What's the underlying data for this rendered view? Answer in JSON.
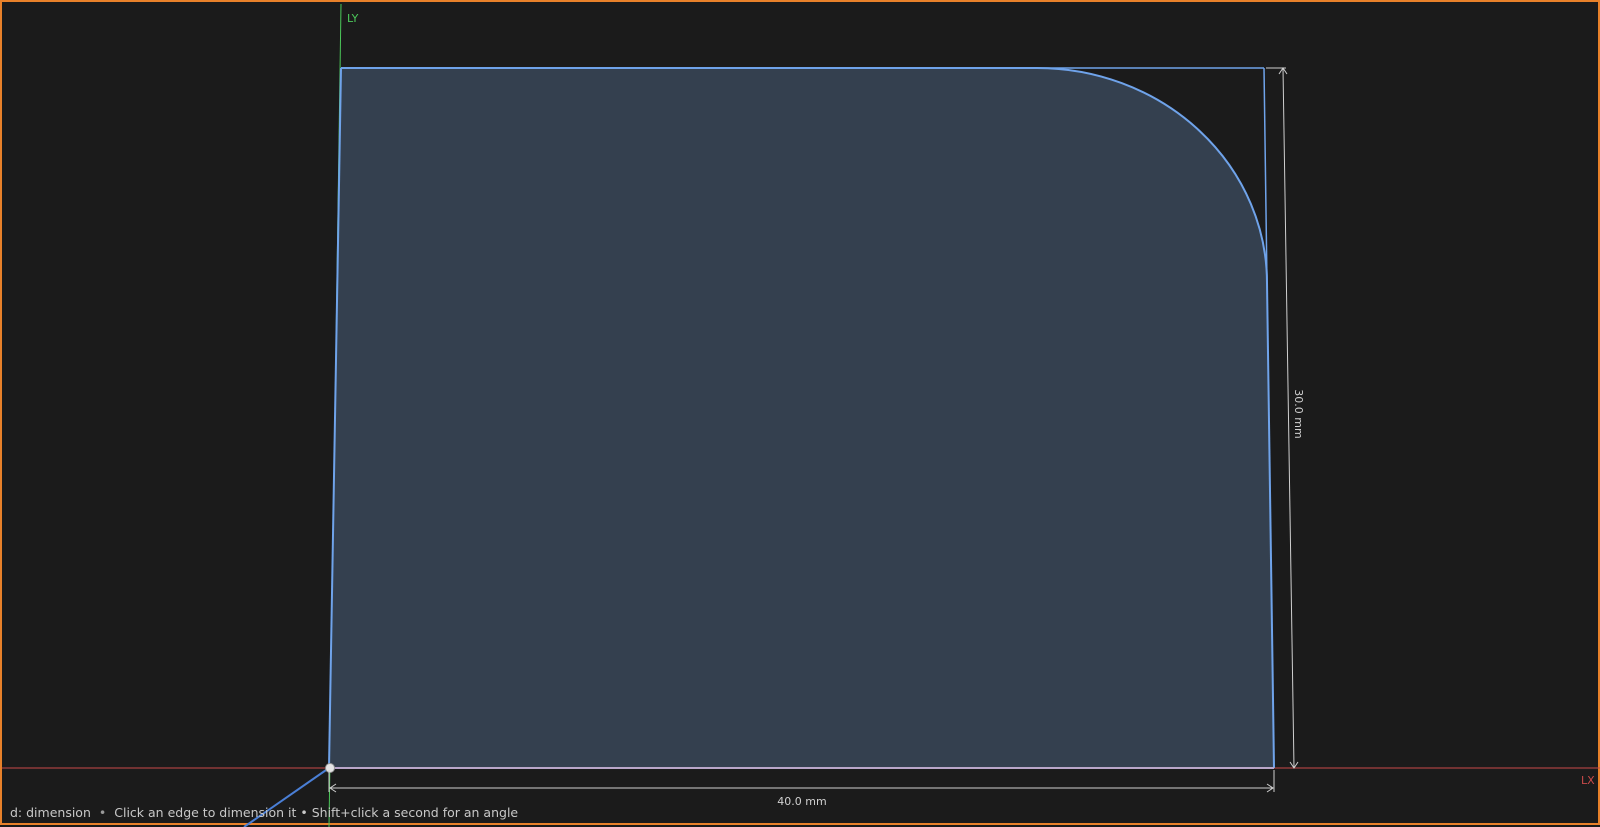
{
  "viewport": {
    "accent_border": "#e8812a",
    "background": "#1b1b1b"
  },
  "axes": {
    "x_label": "LX",
    "y_label": "LY",
    "x_color": "#c94a4a",
    "y_color": "#4cc85a"
  },
  "sketch": {
    "fill": "#34404f",
    "stroke": "#6fa3ea",
    "bottom_edge_color": "#b9a6c9"
  },
  "dimensions": {
    "width_label": "40.0 mm",
    "height_label": "30.0 mm",
    "line_color": "#cfcfcf"
  },
  "status": {
    "mode": "d: dimension",
    "separator": "•",
    "hint": "Click an edge to dimension it • Shift+click a second for an angle"
  }
}
